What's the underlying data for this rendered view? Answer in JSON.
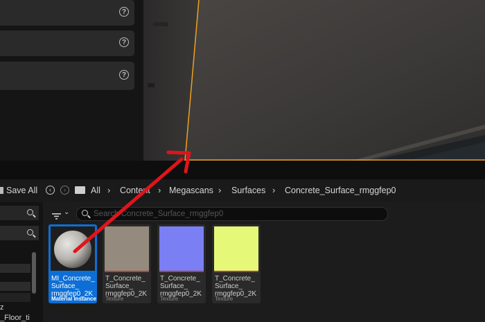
{
  "toolbar": {
    "save_all_label": "Save All",
    "breadcrumbs": [
      "All",
      "Content",
      "Megascans",
      "Surfaces",
      "Concrete_Surface_rmggfep0"
    ]
  },
  "search": {
    "placeholder": "Search Concrete_Surface_rmggfep0"
  },
  "tree": {
    "items": [
      "z",
      "_Floor_ti"
    ]
  },
  "assets": [
    {
      "name": "MI_Concrete_\nSurface_\nrmggfep0_2K",
      "type": "Material Instance",
      "color_bar": "#0d6fd6"
    },
    {
      "name": "T_Concrete_\nSurface_\nrmggfep0_2K",
      "type": "Texture",
      "color_bar": "#b3413c"
    },
    {
      "name": "T_Concrete_\nSurface_\nrmggfep0_2K",
      "type": "Texture",
      "color_bar": "#b3413c"
    },
    {
      "name": "T_Concrete_\nSurface_\nrmggfep0_2K",
      "type": "Texture",
      "color_bar": "#b3413c"
    }
  ],
  "colors": {
    "accent_blue": "#0d6fd6",
    "arrow_red": "#e0141b",
    "viewport_line": "#f0a020"
  }
}
